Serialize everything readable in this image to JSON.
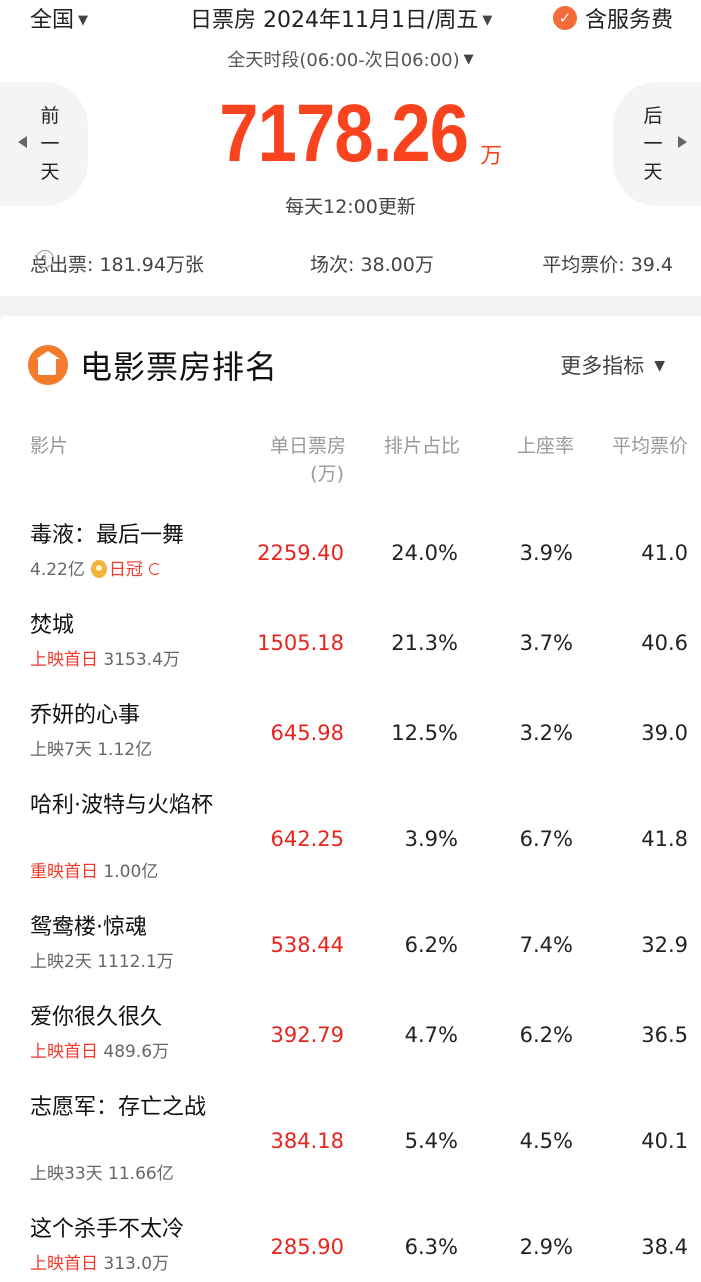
{
  "header": {
    "region": "全国",
    "date_label": "日票房 2024年11月1日/周五",
    "fee_label": "含服务费",
    "period": "全天时段(06:00-次日06:00)",
    "prev_label": "前\n一\n天",
    "next_label": "后\n一\n天",
    "total_box": "7178.26",
    "total_unit": "万",
    "update_note": "每天12:00更新"
  },
  "stats": {
    "tickets": "总出票: 181.94万张",
    "shows": "场次: 38.00万",
    "avg_price": "平均票价: 39.4"
  },
  "ranking": {
    "title": "电影票房排名",
    "more_label": "更多指标",
    "columns": {
      "film": "影片",
      "box": "单日票房",
      "box_unit": "(万)",
      "share": "排片占比",
      "seat": "上座率",
      "avg": "平均票价"
    },
    "rows": [
      {
        "name": "毒液：最后一舞",
        "meta_highlight": "",
        "meta_text": "4.22亿",
        "crown": "日冠",
        "box": "2259.40",
        "share": "24.0%",
        "seat": "3.9%",
        "avg": "41.0"
      },
      {
        "name": "焚城",
        "meta_highlight": "上映首日",
        "meta_text": "3153.4万",
        "crown": "",
        "box": "1505.18",
        "share": "21.3%",
        "seat": "3.7%",
        "avg": "40.6"
      },
      {
        "name": "乔妍的心事",
        "meta_highlight": "",
        "meta_text": "上映7天 1.12亿",
        "crown": "",
        "box": "645.98",
        "share": "12.5%",
        "seat": "3.2%",
        "avg": "39.0"
      },
      {
        "name": "哈利·波特与火焰杯",
        "meta_highlight": "重映首日",
        "meta_text": "1.00亿",
        "crown": "",
        "box": "642.25",
        "share": "3.9%",
        "seat": "6.7%",
        "avg": "41.8"
      },
      {
        "name": "鸳鸯楼·惊魂",
        "meta_highlight": "",
        "meta_text": "上映2天 1112.1万",
        "crown": "",
        "box": "538.44",
        "share": "6.2%",
        "seat": "7.4%",
        "avg": "32.9"
      },
      {
        "name": "爱你很久很久",
        "meta_highlight": "上映首日",
        "meta_text": "489.6万",
        "crown": "",
        "box": "392.79",
        "share": "4.7%",
        "seat": "6.2%",
        "avg": "36.5"
      },
      {
        "name": "志愿军：存亡之战",
        "meta_highlight": "",
        "meta_text": "上映33天 11.66亿",
        "crown": "",
        "box": "384.18",
        "share": "5.4%",
        "seat": "4.5%",
        "avg": "40.1"
      },
      {
        "name": "这个杀手不太冷",
        "meta_highlight": "上映首日",
        "meta_text": "313.0万",
        "crown": "",
        "box": "285.90",
        "share": "6.3%",
        "seat": "2.9%",
        "avg": "38.4"
      }
    ]
  },
  "colors": {
    "accent": "#f8431e",
    "box_red": "#e8241e",
    "icon_orange": "#f47a2c"
  }
}
